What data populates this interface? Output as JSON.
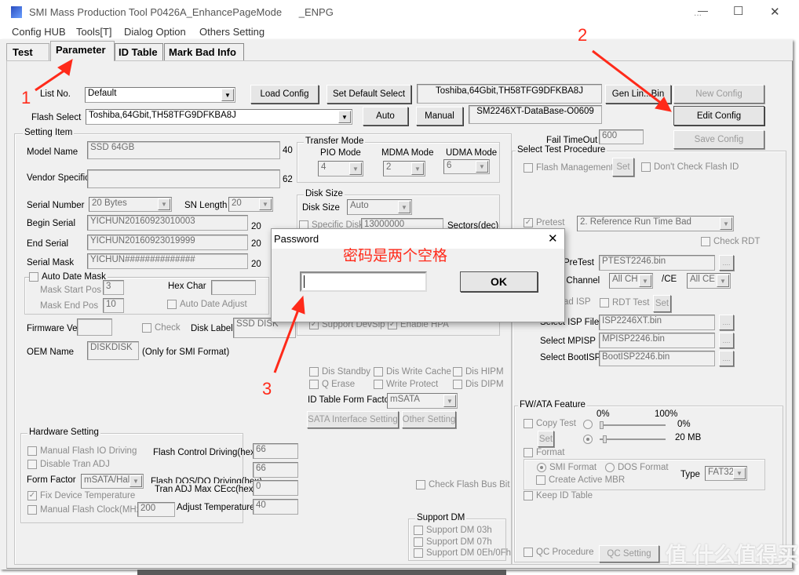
{
  "window": {
    "title": "SMI Mass Production Tool P0426A_EnhancePageMode      _ENPG",
    "minimize": "—",
    "maximize": "☐",
    "close": "✕",
    "extra": "..."
  },
  "menu": [
    "Config HUB",
    "Tools[T]",
    "Dialog Option",
    "Others Setting"
  ],
  "tabs": [
    {
      "label": "Test"
    },
    {
      "label": "Parameter",
      "selected": true
    },
    {
      "label": "ID Table"
    },
    {
      "label": "Mark Bad Info"
    }
  ],
  "top": {
    "list_no_label": "List No.",
    "list_no_value": "Default",
    "load_config": "Load Config",
    "set_default_select": "Set Default Select",
    "flash_info": "Toshiba,64Gbit,TH58TFG9DFKBA8J",
    "gen_bin": "Gen Lin...Bin",
    "new_config": "New Config",
    "flash_select_label": "Flash Select",
    "flash_select_value": "Toshiba,64Gbit,TH58TFG9DFKBA8J",
    "auto": "Auto",
    "manual": "Manual",
    "database": "SM2246XT-DataBase-O0609",
    "edit_config": "Edit Config",
    "fail_timeout_label": "Fail TimeOut",
    "fail_timeout_value": "600",
    "save_config": "Save Config"
  },
  "setting": {
    "title": "Setting Item",
    "model_name_label": "Model Name",
    "model_name": "SSD 64GB",
    "model_len": "40",
    "vendor_label": "Vendor Specific",
    "vendor": "",
    "vendor_len": "62",
    "serial_number_label": "Serial Number",
    "serial_number": "20 Bytes",
    "sn_length_label": "SN Length",
    "sn_length": "20",
    "begin_serial_label": "Begin Serial",
    "begin_serial": "YICHUN20160923010003",
    "begin_len": "20",
    "end_serial_label": "End Serial",
    "end_serial": "YICHUN20160923019999",
    "end_len": "20",
    "serial_mask_label": "Serial Mask",
    "serial_mask": "YICHUN##############",
    "mask_len": "20",
    "auto_date_mask": "Auto Date Mask",
    "mask_start_label": "Mask Start Pos",
    "mask_start": "3",
    "hex_char_label": "Hex Char",
    "hex_char": "",
    "mask_end_label": "Mask End Pos",
    "mask_end": "10",
    "auto_date_adjust": "Auto Date Adjust",
    "fw_version_label": "Firmware Version",
    "fw_version": "",
    "check": "Check",
    "disk_label_label": "Disk Label",
    "disk_label": "SSD DISK",
    "oem_label": "OEM Name",
    "oem": "DISKDISK",
    "oem_note": "(Only for SMI Format)"
  },
  "transfer": {
    "title": "Transfer Mode",
    "pio_label": "PIO Mode",
    "pio": "4",
    "mdma_label": "MDMA Mode",
    "mdma": "2",
    "udma_label": "UDMA Mode",
    "udma": "6"
  },
  "disk": {
    "title": "Disk Size",
    "label": "Disk Size",
    "value": "Auto",
    "specific": "Specific Disk Size",
    "sectors": "13000000",
    "unit": "Sectors(dec)",
    "devslp": "Support DevSlp",
    "hpa": "Enable HPA"
  },
  "features": {
    "dis_standby": "Dis Standby",
    "dis_write_cache": "Dis Write Cache",
    "dis_hipm": "Dis HIPM",
    "q_erase": "Q Erase",
    "write_protect": "Write Protect",
    "dis_dipm": "Dis DIPM",
    "form_factor_label": "ID Table Form Factor",
    "form_factor": "mSATA",
    "sata_setting": "SATA Interface Setting",
    "other_setting": "Other Setting",
    "check_flash_bus": "Check Flash Bus Bit"
  },
  "hardware": {
    "title": "Hardware Setting",
    "manual_io": "Manual Flash IO Driving",
    "disable_tran": "Disable Tran ADJ",
    "form_factor_label": "Form Factor",
    "form_factor": "mSATA/HalfS",
    "fix_temp": "Fix Device Temperature",
    "manual_clock": "Manual Flash Clock(MHz)",
    "clock": "200",
    "ctrl_driving_label": "Flash Control Driving(hex)",
    "ctrl_driving": "66",
    "dqs_driving_label": "Flash DQS/DQ Driving(hex)",
    "dqs_driving": "66",
    "tran_adj_label": "Tran ADJ Max CEcc(hex)",
    "tran_adj": "0",
    "adjust_temp_label": "Adjust Temperature",
    "adjust_temp": "40"
  },
  "support_dm": {
    "title": "Support DM",
    "items": [
      "Support DM 03h",
      "Support DM 07h",
      "Support DM 0Eh/0Fh"
    ]
  },
  "procedure": {
    "title": "Select Test Procedure",
    "flash_mgmt": "Flash Management",
    "set": "Set",
    "dont_check": "Don't Check Flash ID",
    "pretest": "Pretest",
    "pretest_mode": "2. Reference Run Time Bad",
    "check_rdt": "Check RDT",
    "pretest_file_label": "PreTest",
    "pretest_file": "PTEST2246.bin",
    "browse": "....",
    "channel_label": "/ Channel",
    "channel": "All CH",
    "ce_label": "/CE",
    "ce": "All CE",
    "load_isp": "ad ISP",
    "rdt_test": "RDT Test",
    "isp_label": "Select ISP File",
    "isp": "ISP2246XT.bin",
    "mpisp_label": "Select MPISP",
    "mpisp": "MPISP2246.bin",
    "boot_label": "Select BootISP",
    "boot": "BootISP2246.bin"
  },
  "fwata": {
    "title": "FW/ATA Feature",
    "copy_test": "Copy Test",
    "set": "Set",
    "min": "0%",
    "max": "100%",
    "percent_value": "0%",
    "size_value": "20 MB",
    "percent_level": 0,
    "size_level": 0.05,
    "format": "Format",
    "smi_format": "SMI Format",
    "dos_format": "DOS Format",
    "create_mbr": "Create Active MBR",
    "type_label": "Type",
    "type": "FAT32",
    "keep_id": "Keep ID Table",
    "qc_procedure": "QC Procedure",
    "qc_setting": "QC Setting"
  },
  "dialog": {
    "title": "Password",
    "close": "✕",
    "note": "密码是两个空格",
    "password": "",
    "ok": "OK"
  },
  "annotations": {
    "step1": "1",
    "step2": "2",
    "step3": "3",
    "color": "#ff2a1a"
  },
  "watermark": "值 什么值得买"
}
